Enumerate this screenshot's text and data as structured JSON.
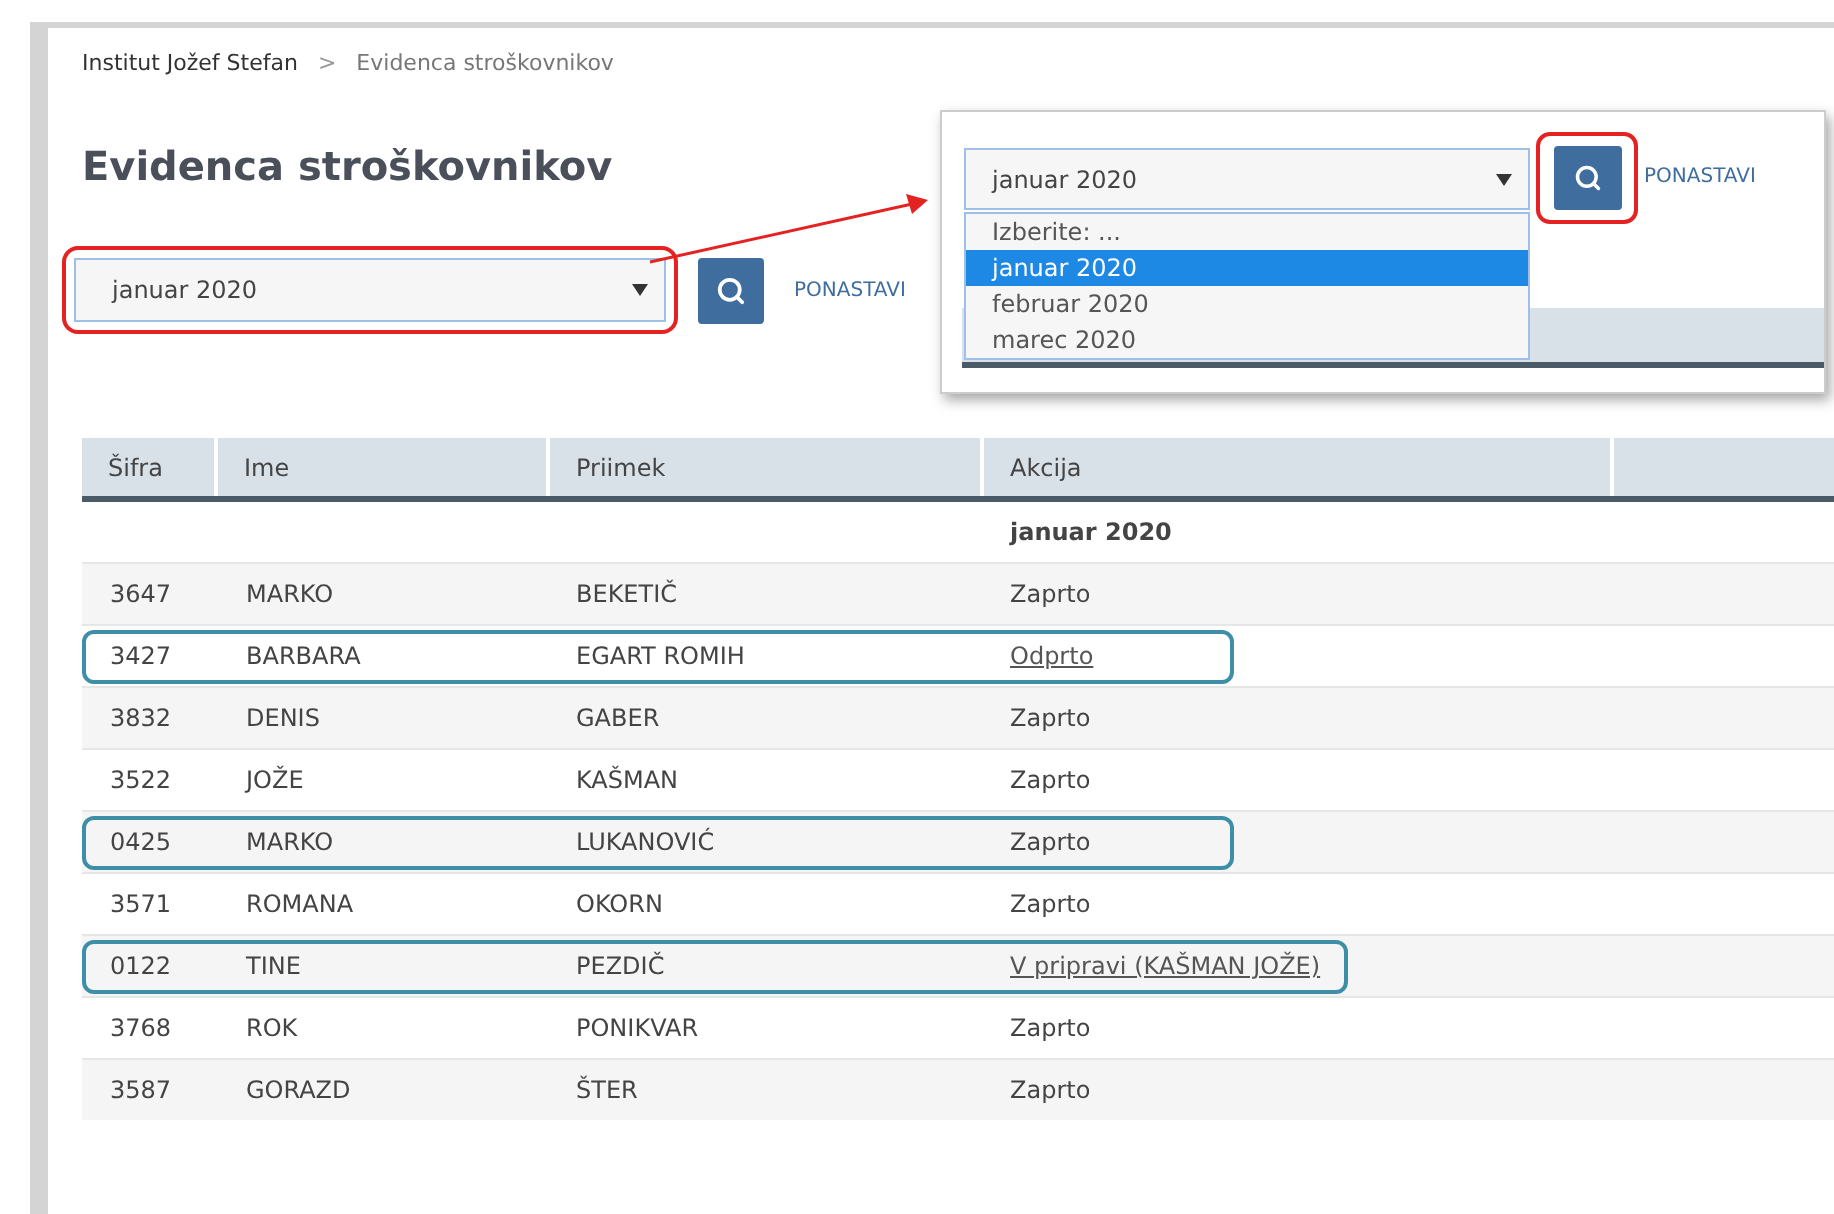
{
  "breadcrumb": {
    "items": [
      "Institut Jožef Stefan",
      "Evidenca stroškovnikov"
    ],
    "separator": ">"
  },
  "title": "Evidenca stroškovnikov",
  "filter": {
    "select_value": "januar 2020",
    "reset": "PONASTAVI",
    "highlighted": true
  },
  "dropdown_inset": {
    "select_value": "januar 2020",
    "reset": "PONASTAVI",
    "button_highlighted": true,
    "options": [
      {
        "label": "Izberite: ...",
        "selected": false
      },
      {
        "label": "januar 2020",
        "selected": true
      },
      {
        "label": "februar 2020",
        "selected": false
      },
      {
        "label": "marec 2020",
        "selected": false
      }
    ]
  },
  "table": {
    "columns": [
      "Šifra",
      "Ime",
      "Priimek",
      "Akcija"
    ],
    "group": "januar 2020",
    "rows": [
      {
        "code": "3647",
        "first_name": "MARKO",
        "last_name": "BEKETIČ",
        "action": "Zaprto",
        "link": false,
        "highlighted": false
      },
      {
        "code": "3427",
        "first_name": "BARBARA",
        "last_name": "EGART ROMIH",
        "action": "Odprto",
        "link": true,
        "highlighted": true
      },
      {
        "code": "3832",
        "first_name": "DENIS",
        "last_name": "GABER",
        "action": "Zaprto",
        "link": false,
        "highlighted": false
      },
      {
        "code": "3522",
        "first_name": "JOŽE",
        "last_name": "KAŠMAN",
        "action": "Zaprto",
        "link": false,
        "highlighted": false
      },
      {
        "code": "0425",
        "first_name": "MARKO",
        "last_name": "LUKANOVIĆ",
        "action": "Zaprto",
        "link": false,
        "highlighted": true
      },
      {
        "code": "3571",
        "first_name": "ROMANA",
        "last_name": "OKORN",
        "action": "Zaprto",
        "link": false,
        "highlighted": false
      },
      {
        "code": "0122",
        "first_name": "TINE",
        "last_name": "PEZDIČ",
        "action": "V pripravi (KAŠMAN JOŽE)",
        "link": true,
        "highlighted": true
      },
      {
        "code": "3768",
        "first_name": "ROK",
        "last_name": "PONIKVAR",
        "action": "Zaprto",
        "link": false,
        "highlighted": false
      },
      {
        "code": "3587",
        "first_name": "GORAZD",
        "last_name": "ŠTER",
        "action": "Zaprto",
        "link": false,
        "highlighted": false
      }
    ]
  }
}
